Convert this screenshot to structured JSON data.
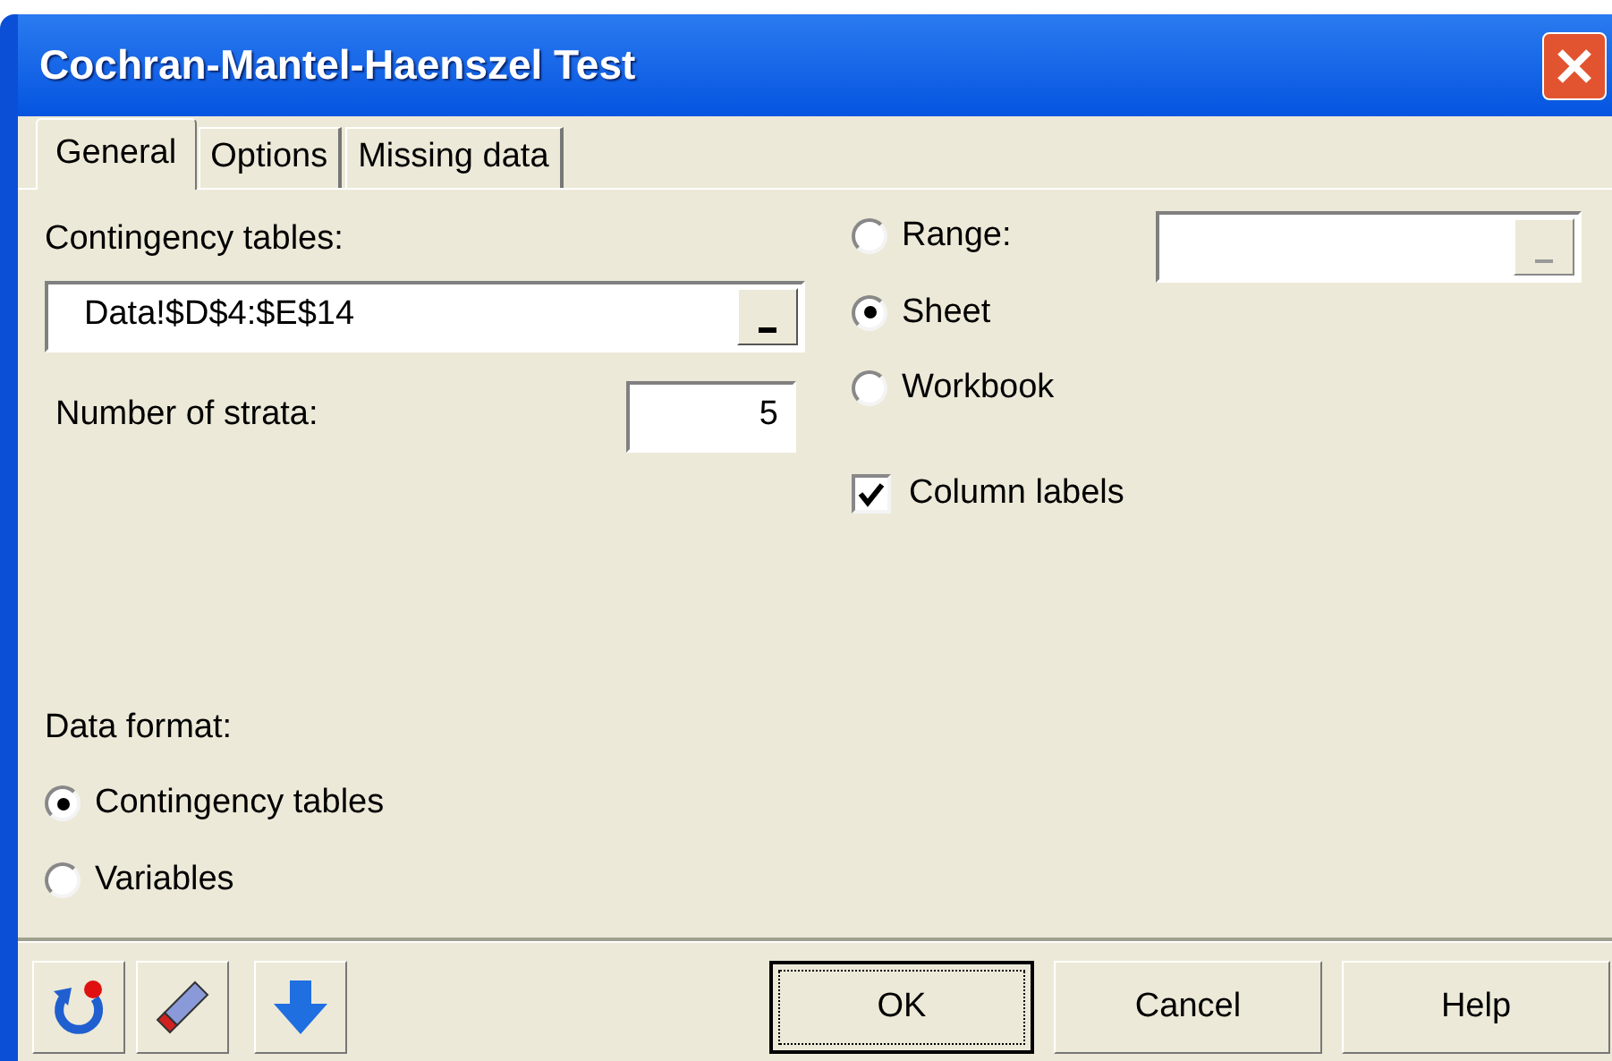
{
  "window": {
    "title": "Cochran-Mantel-Haenszel Test"
  },
  "tabs": [
    {
      "label": "General",
      "selected": true
    },
    {
      "label": "Options",
      "selected": false
    },
    {
      "label": "Missing data",
      "selected": false
    }
  ],
  "contingency_tables": {
    "label": "Contingency tables:",
    "value": "Data!$D$4:$E$14"
  },
  "strata": {
    "label": "Number of strata:",
    "value": "5"
  },
  "source": [
    {
      "label": "Range:",
      "selected": false
    },
    {
      "label": "Sheet",
      "selected": true
    },
    {
      "label": "Workbook",
      "selected": false
    }
  ],
  "column_labels": {
    "label": "Column labels",
    "checked": true
  },
  "data_format": {
    "label": "Data format:",
    "options": [
      {
        "label": "Contingency tables",
        "selected": true
      },
      {
        "label": "Variables",
        "selected": false
      }
    ]
  },
  "buttons": [
    "OK",
    "Cancel",
    "Help"
  ]
}
